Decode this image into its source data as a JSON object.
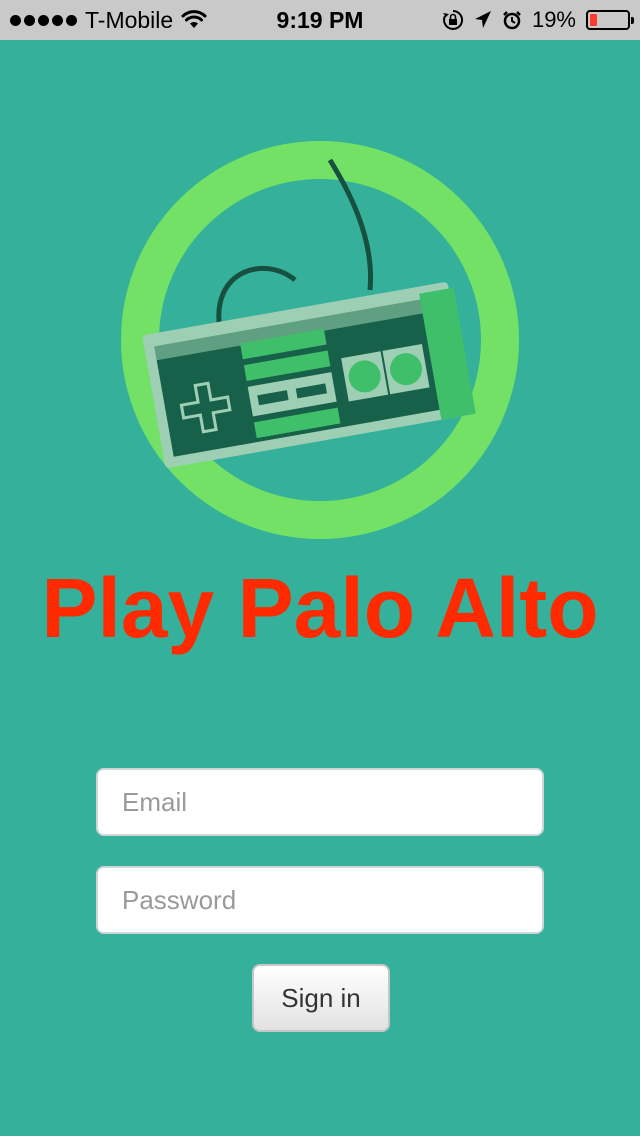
{
  "status_bar": {
    "carrier": "T-Mobile",
    "time": "9:19 PM",
    "battery_percent": "19%",
    "battery_level": 0.19,
    "icons": [
      "signal-icon",
      "wifi-icon",
      "rotation-lock-icon",
      "location-arrow-icon",
      "alarm-icon",
      "battery-icon"
    ],
    "battery_color": "#ff3b30"
  },
  "app": {
    "title": "Play Palo Alto",
    "title_color": "#ff2a00",
    "background_color": "#35b09a",
    "logo_icon": "game-controller-icon"
  },
  "login": {
    "email_placeholder": "Email",
    "password_placeholder": "Password",
    "signin_label": "Sign in"
  }
}
